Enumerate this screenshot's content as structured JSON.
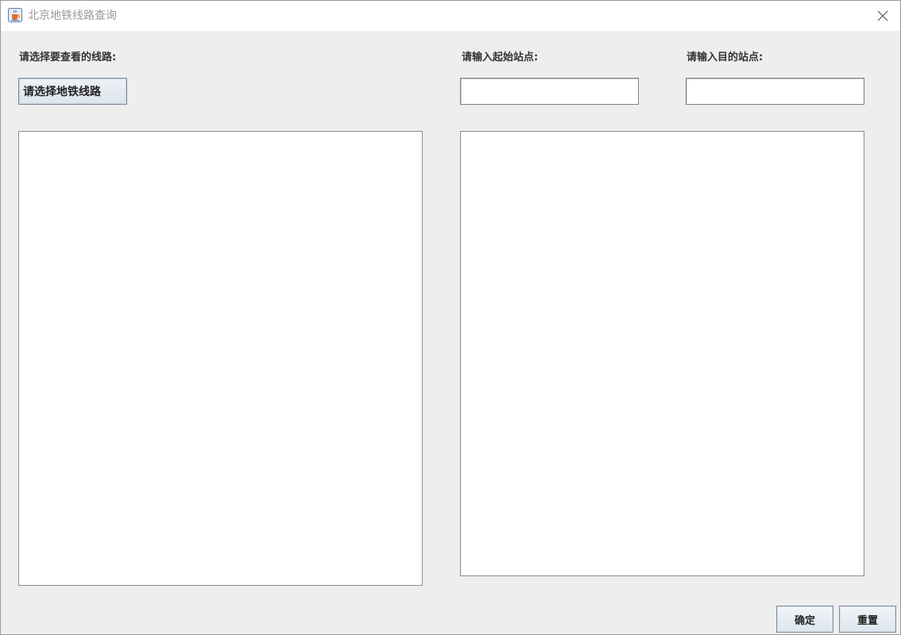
{
  "window": {
    "title": "北京地铁线路查询"
  },
  "left_panel": {
    "line_label": "请选择要查看的线路:",
    "line_select_button": "请选择地铁线路",
    "line_output_text": ""
  },
  "right_panel": {
    "start_label": "请输入起始站点:",
    "start_value": "",
    "end_label": "请输入目的站点:",
    "end_value": "",
    "route_output_text": ""
  },
  "buttons": {
    "confirm": "确定",
    "reset": "重置"
  },
  "colors": {
    "background": "#eeeeee",
    "titlebar": "#ffffff",
    "title_text": "#999999"
  },
  "icons": {
    "app": "java-coffee-cup-icon",
    "close": "close-icon"
  }
}
